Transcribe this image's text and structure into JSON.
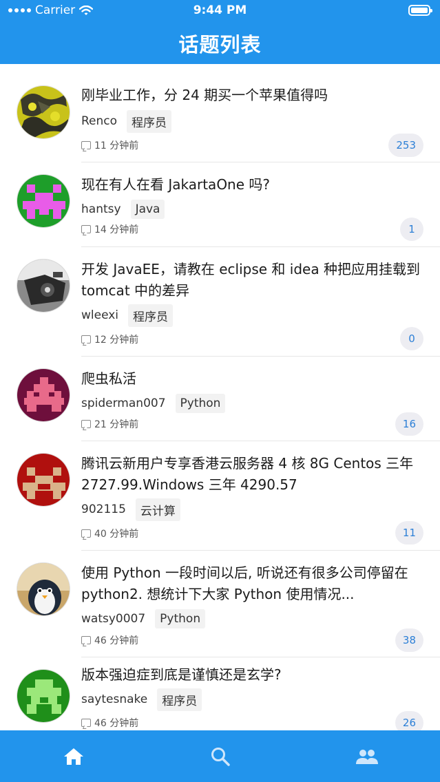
{
  "status_bar": {
    "carrier": "Carrier",
    "time": "9:44 PM"
  },
  "header": {
    "title": "话题列表"
  },
  "colors": {
    "primary": "#2294ec",
    "count_text": "#2c7fd6",
    "count_bg": "#ededf2",
    "tag_bg": "#f2f2f2"
  },
  "topics": [
    {
      "title": "刚毕业工作，分 24 期买一个苹果值得吗",
      "author": "Renco",
      "tag": "程序员",
      "time": "11 分钟前",
      "replies": "253"
    },
    {
      "title": "现在有人在看 JakartaOne 吗?",
      "author": "hantsy",
      "tag": "Java",
      "time": "14 分钟前",
      "replies": "1"
    },
    {
      "title": "开发 JavaEE，请教在 eclipse 和 idea 种把应用挂载到 tomcat 中的差异",
      "author": "wleexi",
      "tag": "程序员",
      "time": "12 分钟前",
      "replies": "0"
    },
    {
      "title": "爬虫私活",
      "author": "spiderman007",
      "tag": "Python",
      "time": "21 分钟前",
      "replies": "16"
    },
    {
      "title": "腾讯云新用户专享香港云服务器 4 核 8G Centos 三年 2727.99.Windows 三年 4290.57",
      "author": "902115",
      "tag": "云计算",
      "time": "40 分钟前",
      "replies": "11"
    },
    {
      "title": "使用 Python 一段时间以后, 听说还有很多公司停留在 python2. 想统计下大家 Python 使用情况...",
      "author": "watsy0007",
      "tag": "Python",
      "time": "46 分钟前",
      "replies": "38"
    },
    {
      "title": "版本强迫症到底是谨慎还是玄学?",
      "author": "saytesnake",
      "tag": "程序员",
      "time": "46 分钟前",
      "replies": "26"
    }
  ],
  "tabbar": {
    "tabs": [
      {
        "name": "home",
        "icon": "home-icon",
        "active": true
      },
      {
        "name": "search",
        "icon": "search-icon",
        "active": false
      },
      {
        "name": "users",
        "icon": "users-icon",
        "active": false
      }
    ]
  }
}
